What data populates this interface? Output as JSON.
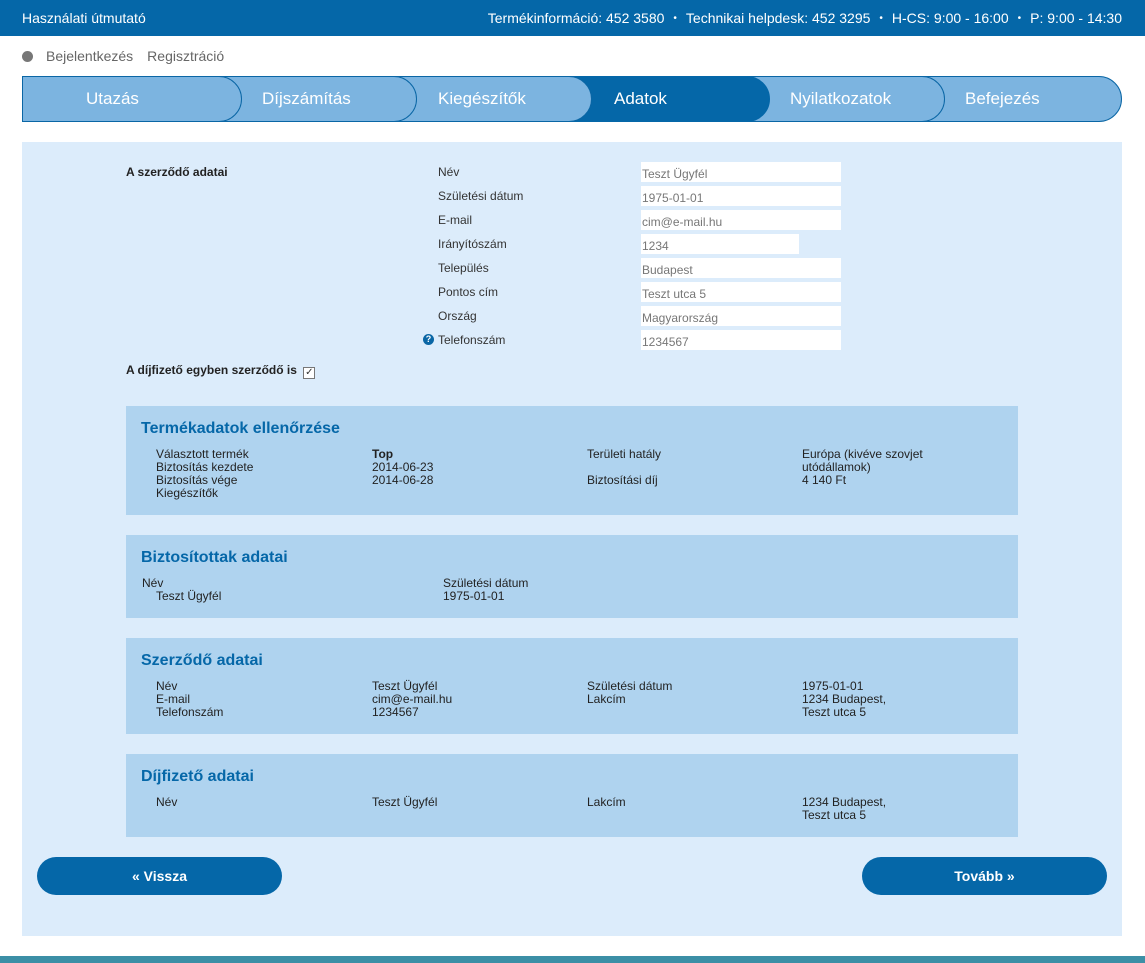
{
  "topbar": {
    "manual": "Használati útmutató",
    "product_info": "Termékinformáció: 452 3580",
    "helpdesk": "Technikai helpdesk: 452 3295",
    "hours_weekday": "H-CS: 9:00 - 16:00",
    "hours_friday": "P: 9:00 - 14:30",
    "separator": "•"
  },
  "auth": {
    "login": "Bejelentkezés",
    "register": "Regisztráció"
  },
  "steps": [
    "Utazás",
    "Díjszámítás",
    "Kiegészítők",
    "Adatok",
    "Nyilatkozatok",
    "Befejezés"
  ],
  "contract_form": {
    "section_label": "A szerződő adatai",
    "fields": [
      {
        "label": "Név",
        "value": "Teszt Ügyfél"
      },
      {
        "label": "Születési dátum",
        "value": "1975-01-01"
      },
      {
        "label": "E-mail",
        "value": "cim@e-mail.hu"
      },
      {
        "label": "Irányítószám",
        "value": "1234"
      },
      {
        "label": "Település",
        "value": "Budapest"
      },
      {
        "label": "Pontos cím",
        "value": "Teszt utca 5"
      },
      {
        "label": "Ország",
        "value": "Magyarország"
      },
      {
        "label": "Telefonszám",
        "value": "1234567"
      }
    ],
    "payer_is_contractor": "A díjfizető egyben szerződő is",
    "checkmark": "✓"
  },
  "product_check": {
    "title": "Termékadatok ellenőrzése",
    "selected_product_label": "Választott termék",
    "selected_product": "Top",
    "start_label": "Biztosítás kezdete",
    "start": "2014-06-23",
    "end_label": "Biztosítás vége",
    "end": "2014-06-28",
    "addons_label": "Kiegészítők",
    "scope_label": "Területi hatály",
    "scope_line1": "Európa (kivéve szovjet",
    "scope_line2": "utódállamok)",
    "fee_label": "Biztosítási díj",
    "fee": "4 140 Ft"
  },
  "insured": {
    "title": "Biztosítottak adatai",
    "name_label": "Név",
    "birth_label": "Születési dátum",
    "name": "Teszt Ügyfél",
    "birth": "1975-01-01"
  },
  "contractor": {
    "title": "Szerződő adatai",
    "name_label": "Név",
    "name": "Teszt Ügyfél",
    "email_label": "E-mail",
    "email": "cim@e-mail.hu",
    "phone_label": "Telefonszám",
    "phone": "1234567",
    "birth_label": "Születési dátum",
    "birth": "1975-01-01",
    "address_label": "Lakcím",
    "address_line1": "1234 Budapest,",
    "address_line2": "Teszt utca 5"
  },
  "payer": {
    "title": "Díjfizető adatai",
    "name_label": "Név",
    "name": "Teszt Ügyfél",
    "address_label": "Lakcím",
    "address_line1": "1234 Budapest,",
    "address_line2": "Teszt utca 5"
  },
  "buttons": {
    "back": "« Vissza",
    "next": "Tovább »"
  },
  "help_icon": "?"
}
